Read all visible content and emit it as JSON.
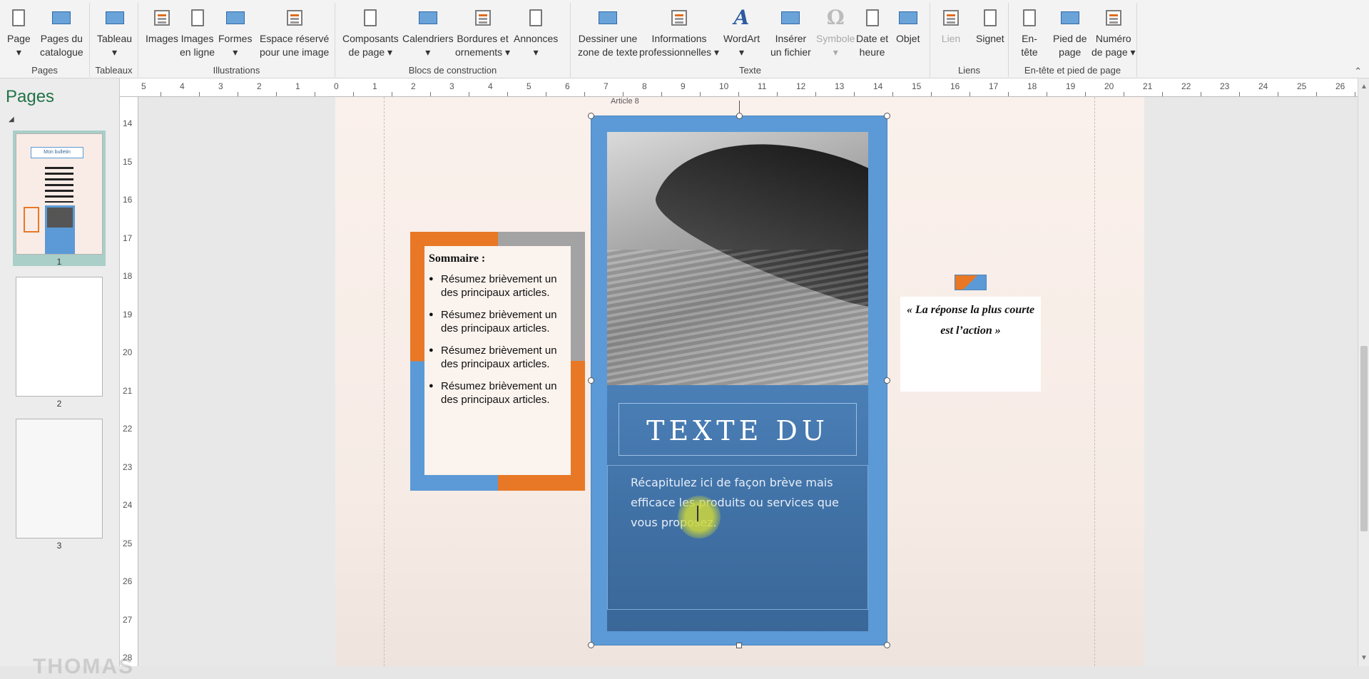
{
  "ribbon": {
    "groups": [
      {
        "label": "Pages",
        "buttons": [
          {
            "label": "Page",
            "sub": "▾",
            "icon": "page-icon"
          },
          {
            "label": "Pages du",
            "sub": "catalogue",
            "icon": "catalog-pages-icon"
          }
        ]
      },
      {
        "label": "Tableaux",
        "buttons": [
          {
            "label": "Tableau",
            "sub": "▾",
            "icon": "table-icon"
          }
        ]
      },
      {
        "label": "Illustrations",
        "buttons": [
          {
            "label": "Images",
            "sub": "",
            "icon": "images-icon"
          },
          {
            "label": "Images",
            "sub": "en ligne",
            "icon": "online-images-icon"
          },
          {
            "label": "Formes",
            "sub": "▾",
            "icon": "shapes-icon"
          },
          {
            "label": "Espace réservé",
            "sub": "pour une image",
            "icon": "image-placeholder-icon"
          }
        ]
      },
      {
        "label": "Blocs de construction",
        "buttons": [
          {
            "label": "Composants",
            "sub": "de page ▾",
            "icon": "page-parts-icon"
          },
          {
            "label": "Calendriers",
            "sub": "▾",
            "icon": "calendar-icon"
          },
          {
            "label": "Bordures et",
            "sub": "ornements ▾",
            "icon": "borders-icon"
          },
          {
            "label": "Annonces",
            "sub": "▾",
            "icon": "ads-icon"
          }
        ]
      },
      {
        "label": "Texte",
        "buttons": [
          {
            "label": "Dessiner une",
            "sub": "zone de texte",
            "icon": "text-box-icon"
          },
          {
            "label": "Informations",
            "sub": "professionnelles ▾",
            "icon": "business-info-icon"
          },
          {
            "label": "WordArt",
            "sub": "▾",
            "icon": "wordart-icon"
          },
          {
            "label": "Insérer",
            "sub": "un fichier",
            "icon": "insert-file-icon"
          },
          {
            "label": "Symbole",
            "sub": "▾",
            "icon": "symbol-icon"
          },
          {
            "label": "Date et",
            "sub": "heure",
            "icon": "date-time-icon"
          },
          {
            "label": "Objet",
            "sub": "",
            "icon": "object-icon"
          }
        ]
      },
      {
        "label": "Liens",
        "buttons": [
          {
            "label": "Lien",
            "sub": "",
            "icon": "link-icon"
          },
          {
            "label": "Signet",
            "sub": "",
            "icon": "bookmark-icon"
          }
        ]
      },
      {
        "label": "En-tête et pied de page",
        "buttons": [
          {
            "label": "En-",
            "sub": "tête",
            "icon": "header-icon"
          },
          {
            "label": "Pied de",
            "sub": "page",
            "icon": "footer-icon"
          },
          {
            "label": "Numéro",
            "sub": "de page ▾",
            "icon": "page-number-icon"
          }
        ]
      }
    ],
    "collapse_glyph": "⌃"
  },
  "pages_panel": {
    "title": "Pages",
    "pages": [
      {
        "number": "1",
        "selected": true
      },
      {
        "number": "2"
      },
      {
        "number": "3"
      }
    ],
    "thumb1_title": "Mon bulletin"
  },
  "rulers": {
    "h_ticks": [
      "5",
      "4",
      "3",
      "2",
      "1",
      "0",
      "1",
      "2",
      "3",
      "4",
      "5",
      "6",
      "7",
      "8",
      "9",
      "10",
      "11",
      "12",
      "13",
      "14",
      "15",
      "16",
      "17",
      "18",
      "19",
      "20",
      "21",
      "22",
      "23",
      "24",
      "25",
      "26"
    ],
    "v_ticks": [
      "14",
      "15",
      "16",
      "17",
      "18",
      "19",
      "20",
      "21",
      "22",
      "23",
      "24",
      "25",
      "26",
      "27",
      "28"
    ]
  },
  "document": {
    "article_label": "Article 8",
    "sidebar": {
      "heading": "Sommaire :",
      "items": [
        "Résumez brièvement un des principaux articles.",
        "Résumez brièvement un des principaux articles.",
        "Résumez brièvement un des principaux articles.",
        "Résumez brièvement un des principaux articles."
      ]
    },
    "article": {
      "title": "TEXTE DU",
      "body": "Récapitulez ici de façon brève mais efficace les produits ou services que vous proposez."
    },
    "quote": "« La réponse la plus courte est l’action »"
  },
  "watermark": "THOMAS"
}
